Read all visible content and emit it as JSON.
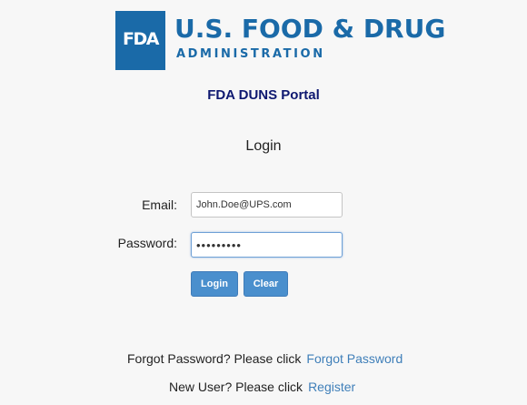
{
  "brand": {
    "logo_box_text": "FDA",
    "title": "U.S. FOOD & DRUG",
    "subtitle": "ADMINISTRATION",
    "color": "#1a6aa8"
  },
  "portal_title": "FDA DUNS Portal",
  "page_heading": "Login",
  "form": {
    "email_label": "Email:",
    "email_value": "John.Doe@UPS.com",
    "password_label": "Password:",
    "password_value": "abcdefghi",
    "login_label": "Login",
    "clear_label": "Clear",
    "button_color": "#4a8fcd"
  },
  "help": {
    "forgot_text": "Forgot Password? Please click",
    "forgot_link": "Forgot Password",
    "register_text": "New User? Please click",
    "register_link": "Register",
    "link_color": "#3f7fb9"
  }
}
